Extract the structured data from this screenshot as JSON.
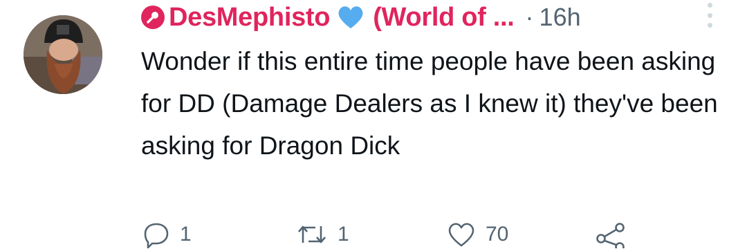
{
  "tweet": {
    "display_name": "DesMephisto",
    "name_suffix": "(World of ...",
    "separator": "·",
    "time": "16h",
    "text": "Wonder if this entire time people have been asking for DD (Damage Dealers as I knew it) they've been asking for Dragon Dick"
  },
  "actions": {
    "replies": "1",
    "retweets": "1",
    "likes": "70"
  },
  "colors": {
    "name": "#e0245e",
    "heart_badge": "#55acee",
    "muted": "#536471"
  },
  "icons": [
    "microphone-icon",
    "blue-heart-icon",
    "more-options-icon",
    "reply-icon",
    "retweet-icon",
    "like-icon",
    "share-icon"
  ]
}
